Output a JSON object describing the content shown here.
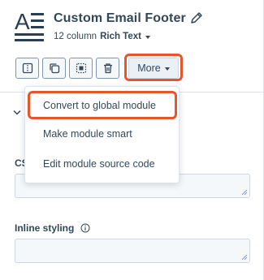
{
  "header": {
    "title": "Custom Email Footer",
    "column_text": "12 column",
    "module_type": "Rich Text"
  },
  "toolbar": {
    "buttons": [
      {
        "icon": "split-icon"
      },
      {
        "icon": "duplicate-icon"
      },
      {
        "icon": "select-icon"
      },
      {
        "icon": "trash-icon"
      }
    ],
    "more_label": "More"
  },
  "menu": {
    "items": [
      {
        "label": "Convert to global module"
      },
      {
        "label": "Make module smart"
      },
      {
        "label": "Edit module source code"
      }
    ]
  },
  "fields": {
    "css_label_partial": "CS",
    "inline_styling_label": "Inline styling"
  },
  "colors": {
    "highlight": "#e8542c",
    "text": "#33475b",
    "border": "#cbd6e2"
  }
}
